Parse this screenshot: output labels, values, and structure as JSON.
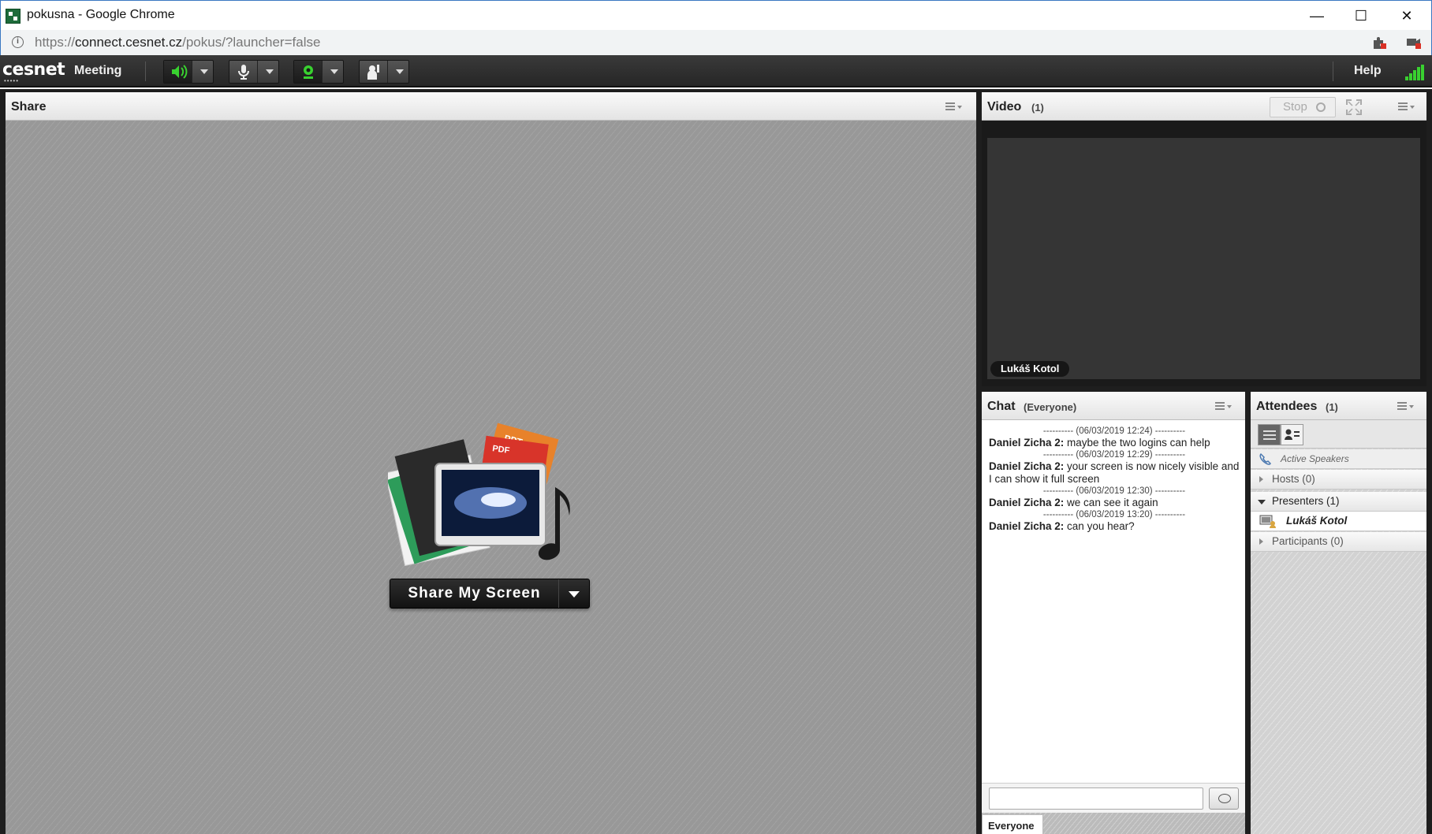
{
  "window": {
    "title": "pokusna - Google Chrome",
    "minimize_glyph": "—",
    "maximize_glyph": "☐",
    "close_glyph": "✕"
  },
  "address": {
    "scheme": "https://",
    "host": "connect.cesnet.cz",
    "path": "/pokus/?launcher=false"
  },
  "appbar": {
    "brand": "cesnet",
    "brand_tagline": "•••••",
    "menu_meeting": "Meeting",
    "help": "Help",
    "speaker_color": "#39d130",
    "camera_color": "#39d130",
    "signal_color": "#39d130"
  },
  "share": {
    "title": "Share",
    "button_label": "Share My Screen",
    "illustration_labels": [
      "PPT",
      "PDF"
    ]
  },
  "video": {
    "title": "Video",
    "count": "(1)",
    "stop_label": "Stop",
    "participant_name": "Lukáš Kotol"
  },
  "chat": {
    "title": "Chat",
    "audience": "(Everyone)",
    "messages": [
      {
        "timestamp": "---------- (06/03/2019 12:24) ----------",
        "sender": "Daniel Zicha 2:",
        "text": "maybe the two logins can help"
      },
      {
        "timestamp": "---------- (06/03/2019 12:29) ----------",
        "sender": "Daniel Zicha 2:",
        "text": "your screen is now nicely visible and I can show it full screen"
      },
      {
        "timestamp": "---------- (06/03/2019 12:30) ----------",
        "sender": "Daniel Zicha 2:",
        "text": "we can see it again"
      },
      {
        "timestamp": "---------- (06/03/2019 13:20) ----------",
        "sender": "Daniel Zicha 2:",
        "text": "can you hear?"
      }
    ],
    "input_value": "",
    "tab_label": "Everyone"
  },
  "attendees": {
    "title": "Attendees",
    "count": "(1)",
    "active_speakers": "Active Speakers",
    "hosts": "Hosts (0)",
    "presenters": "Presenters (1)",
    "presenter_name": "Lukáš Kotol",
    "participants": "Participants (0)"
  }
}
